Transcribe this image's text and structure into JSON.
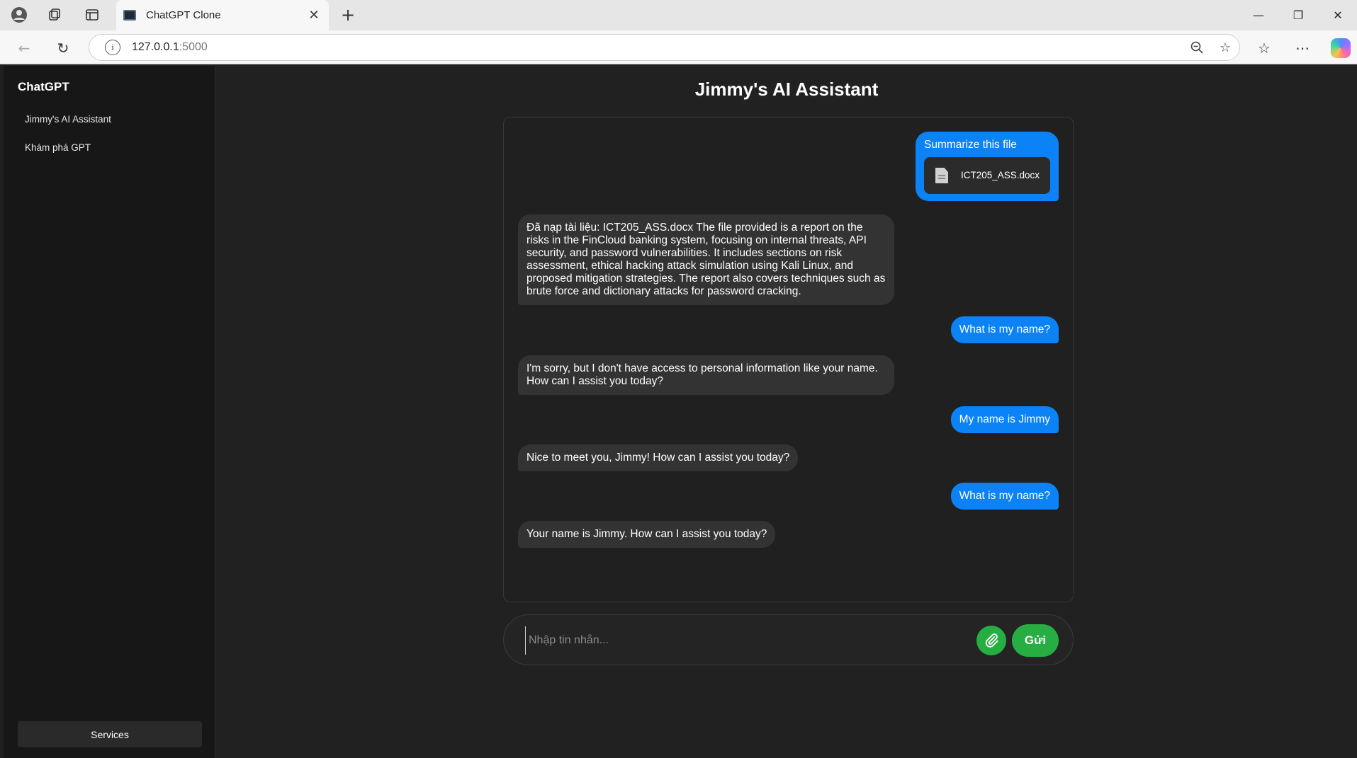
{
  "browser": {
    "tab_title": "ChatGPT Clone",
    "url_host": "127.0.0.1",
    "url_port": ":5000",
    "icons": {
      "profile": "profile-icon",
      "collections": "collections-icon",
      "vertical_tabs": "sidebar-tab-icon",
      "close": "close-icon",
      "new_tab": "plus-icon",
      "back": "arrow-left-icon",
      "refresh": "refresh-icon",
      "info": "info-icon",
      "zoom": "zoom-out-icon",
      "favorite": "star-icon",
      "favorites": "favorites-list-icon",
      "more": "more-icon",
      "copilot": "copilot-icon"
    }
  },
  "sidebar": {
    "title": "ChatGPT",
    "items": [
      {
        "label": "Jimmy's AI Assistant"
      },
      {
        "label": "Khám phá GPT"
      }
    ],
    "services_label": "Services"
  },
  "main": {
    "title": "Jimmy's AI Assistant"
  },
  "chat": {
    "messages": [
      {
        "role": "user",
        "text": "Summarize this file",
        "attachment": "ICT205_ASS.docx"
      },
      {
        "role": "assistant",
        "text": "Đã nạp tài liệu: ICT205_ASS.docx The file provided is a report on the risks in the FinCloud banking system, focusing on internal threats, API security, and password vulnerabilities. It includes sections on risk assessment, ethical hacking attack simulation using Kali Linux, and proposed mitigation strategies. The report also covers techniques such as brute force and dictionary attacks for password cracking."
      },
      {
        "role": "user",
        "text": "What is my name?"
      },
      {
        "role": "assistant",
        "text": "I'm sorry, but I don't have access to personal information like your name. How can I assist you today?"
      },
      {
        "role": "user",
        "text": "My name is Jimmy"
      },
      {
        "role": "assistant",
        "text": "Nice to meet you, Jimmy! How can I assist you today?"
      },
      {
        "role": "user",
        "text": "What is my name?"
      },
      {
        "role": "assistant",
        "text": "Your name is Jimmy. How can I assist you today?"
      }
    ]
  },
  "composer": {
    "placeholder": "Nhập tin nhắn...",
    "value": "",
    "attach_icon": "paperclip-icon",
    "send_label": "Gửi"
  },
  "colors": {
    "user_bubble": "#0b82f5",
    "assistant_bubble": "#333333",
    "accent_green": "#27ae43",
    "background": "#212121",
    "sidebar": "#171717"
  }
}
